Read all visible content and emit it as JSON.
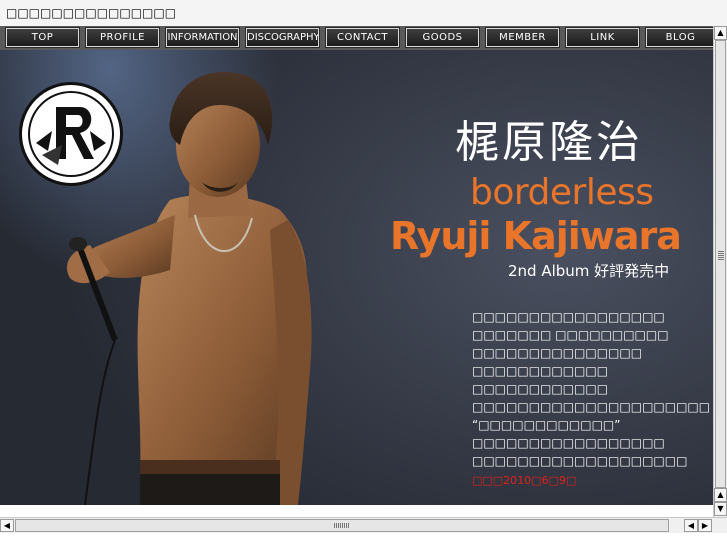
{
  "window": {
    "title": "□□□□□□□□□□□□□□□"
  },
  "nav": {
    "items": [
      {
        "label": "TOP"
      },
      {
        "label": "PROFILE"
      },
      {
        "label": "INFORMATION"
      },
      {
        "label": "DISCOGRAPHY"
      },
      {
        "label": "CONTACT"
      },
      {
        "label": "GOODS"
      },
      {
        "label": "MEMBER"
      },
      {
        "label": "LINK"
      },
      {
        "label": "BLOG"
      }
    ]
  },
  "hero": {
    "artist_kanji": "梶原隆治",
    "album_title": "borderless",
    "artist_romaji": "Ryuji Kajiwara",
    "album_subtitle": "2nd Album 好評発売中",
    "message_lines": [
      "□□□□□□□□□□□□□□□□□",
      "□□□□□□□ □□□□□□□□□□",
      "□□□□□□□□□□□□□□□",
      "□□□□□□□□□□□□",
      "□□□□□□□□□□□□",
      "□□□□□□□□□□□□□□□□□□□□□",
      "“□□□□□□□□□□□□”",
      "□□□□□□□□□□□□□□□□□",
      "□□□□□□□□□□□□□□□□□□□"
    ],
    "release_text": "□□□2010□6□9□"
  },
  "colors": {
    "accent_orange": "#e8752a",
    "release_red": "#e0201a",
    "nav_bg": "#5a5a5a"
  }
}
